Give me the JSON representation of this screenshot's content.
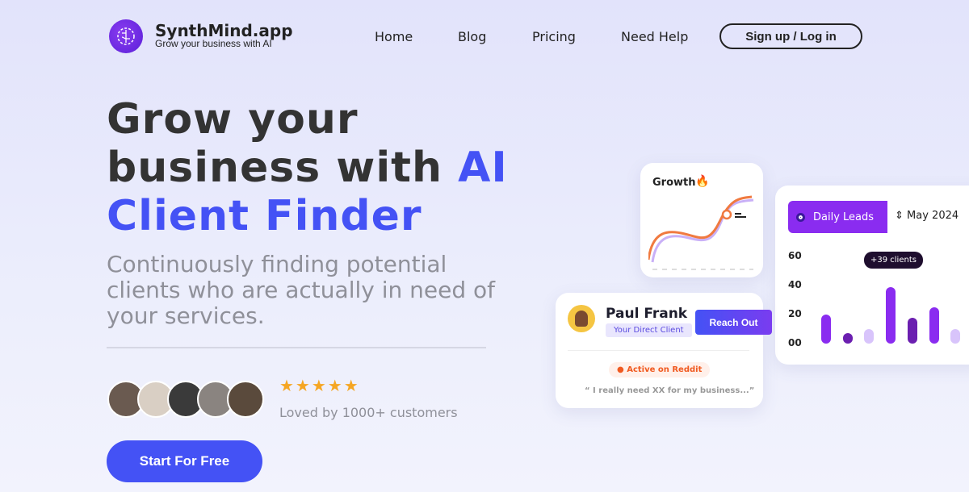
{
  "header": {
    "brand": "SynthMind.app",
    "tagline": "Grow your business with AI",
    "nav": [
      "Home",
      "Blog",
      "Pricing",
      "Need Help"
    ],
    "signup": "Sign up / Log in"
  },
  "hero": {
    "title_line1": "Grow your",
    "title_line2a": "business with ",
    "title_line2b": "AI",
    "title_line3": "Client Finder",
    "subtitle": "Continuously finding potential clients who are actually in need of your services.",
    "rating_stars": 5,
    "stars": "★★★★★",
    "loved": "Loved by 1000+ customers",
    "cta": "Start For Free",
    "accent": "#4452f5"
  },
  "growth_card": {
    "title": "Growth"
  },
  "client_card": {
    "name": "Paul Frank",
    "badge": "Your Direct Client",
    "button": "Reach Out",
    "source": "Active on Reddit",
    "quote": "“ I really need XX for my business...”"
  },
  "leads_card": {
    "tab": "Daily Leads",
    "month": "May 2024",
    "tooltip": "+39 clients"
  },
  "chart_data": {
    "type": "bar",
    "yticks": [
      "60",
      "40",
      "20",
      "00"
    ],
    "ylim": [
      0,
      60
    ],
    "values": [
      20,
      7,
      10,
      39,
      18,
      25,
      10
    ],
    "colors": [
      "#8a2cf0",
      "#6b1fb0",
      "#d8c4fb",
      "#8a2cf0",
      "#6b1fb0",
      "#8a2cf0",
      "#d8c4fb"
    ]
  }
}
